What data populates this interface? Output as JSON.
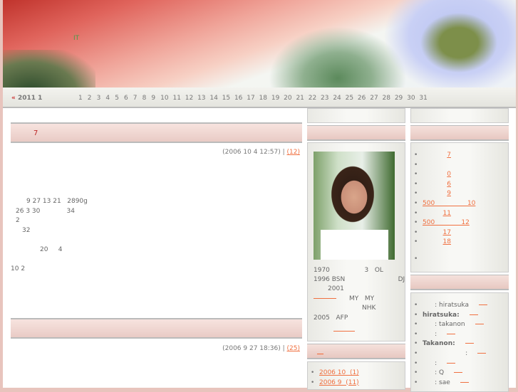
{
  "header": {
    "tagline": "IT"
  },
  "calendar": {
    "prev_arrow": "«",
    "month": "2011 1",
    "days": [
      "1",
      "2",
      "3",
      "4",
      "5",
      "6",
      "7",
      "8",
      "9",
      "10",
      "11",
      "12",
      "13",
      "14",
      "15",
      "16",
      "17",
      "18",
      "19",
      "20",
      "21",
      "22",
      "23",
      "24",
      "25",
      "26",
      "27",
      "28",
      "29",
      "30",
      "31"
    ]
  },
  "posts": [
    {
      "title": "7",
      "meta": "(2006 10  4  12:57) |",
      "comments": "(12)",
      "lines": [
        "9 27 13 21   2890g",
        "26 3 30             34",
        "2",
        "32",
        "20     4",
        "10 2"
      ]
    },
    {
      "title": "",
      "meta": "(2006 9 27  18:36) |",
      "comments": "(25)"
    }
  ],
  "profile": {
    "lines": [
      "1970                 3   OL",
      "1996 BSN                          DJ",
      "2001",
      "MY   MY",
      "NHK",
      "2005   AFP"
    ]
  },
  "archives": {
    "link": "__",
    "items": [
      "2006 10  (1)",
      "2006 9  (11)"
    ]
  },
  "recent": {
    "items": [
      "7",
      "",
      "0",
      "6",
      "9",
      "500                10",
      "11",
      "500             12",
      "17",
      "18",
      ""
    ]
  },
  "comments": {
    "items": [
      {
        "pre": "      : hiratsuka",
        "bold": false
      },
      {
        "pre": "hiratsuka:",
        "bold": true
      },
      {
        "pre": "      : takanon",
        "bold": false
      },
      {
        "pre": "      :",
        "bold": false
      },
      {
        "pre": "Takanon:",
        "bold": true
      },
      {
        "pre": "                     :",
        "bold": false
      },
      {
        "pre": "      :",
        "bold": false
      },
      {
        "pre": "      : Q",
        "bold": false
      },
      {
        "pre": "      : sae",
        "bold": false
      }
    ]
  }
}
